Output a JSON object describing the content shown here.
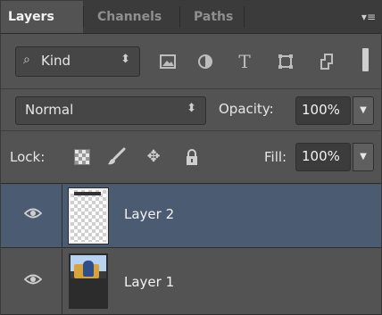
{
  "tabs": [
    {
      "label": "Layers"
    },
    {
      "label": "Channels"
    },
    {
      "label": "Paths"
    }
  ],
  "filter": {
    "kind_label": "Kind",
    "icons": [
      "image-filter-icon",
      "adjustment-filter-icon",
      "type-filter-icon",
      "shape-filter-icon",
      "smart-object-filter-icon"
    ]
  },
  "blend": {
    "mode": "Normal",
    "opacity_label": "Opacity:",
    "opacity_value": "100%"
  },
  "lock": {
    "label": "Lock:",
    "fill_label": "Fill:",
    "fill_value": "100%"
  },
  "layers": [
    {
      "name": "Layer 2",
      "visible": true,
      "selected": true,
      "thumbnail": "transparent"
    },
    {
      "name": "Layer 1",
      "visible": true,
      "selected": false,
      "thumbnail": "photo"
    }
  ],
  "colors": {
    "panel_bg": "#535353",
    "selected_row": "#4b5b72",
    "tabbar_bg": "#3b3b3b"
  }
}
